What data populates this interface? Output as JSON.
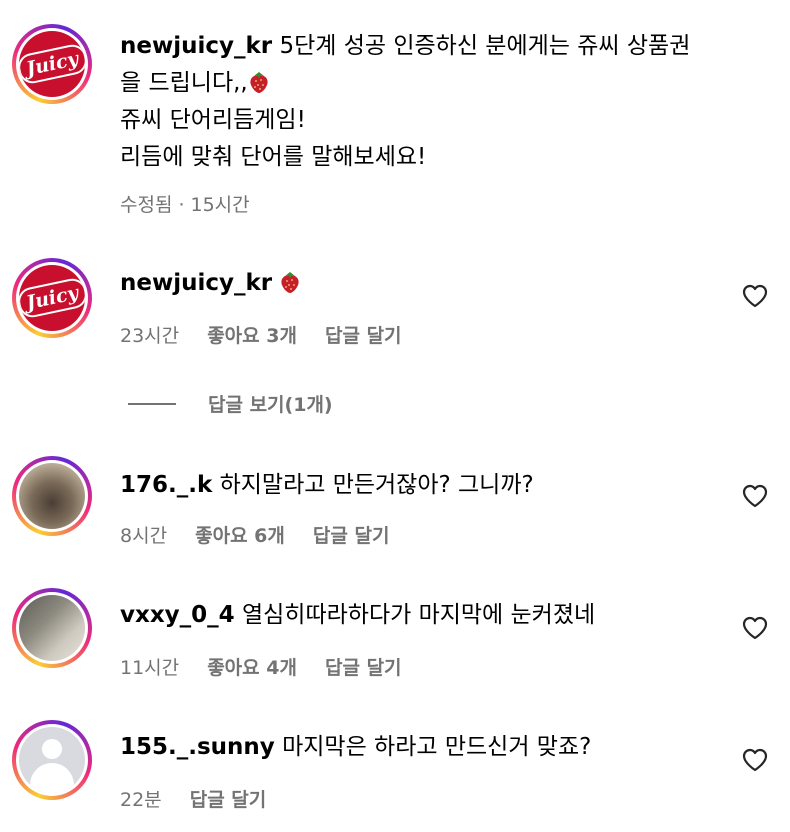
{
  "comments": [
    {
      "username": "newjuicy_kr",
      "text_line1": "5단계 성공 인증하신 분에게는 쥬씨 상품권",
      "text_line2": "을 드립니다,,",
      "text_line3": "쥬씨 단어리듬게임!",
      "text_line4": "리듬에 맞춰 단어를 말해보세요!",
      "edited": "수정됨",
      "separator": "·",
      "time": "15시간"
    },
    {
      "username": "newjuicy_kr",
      "time": "23시간",
      "likes": "좋아요 3개",
      "reply": "답글 달기",
      "view_replies": "답글 보기(1개)"
    },
    {
      "username": "176._.k",
      "text": "하지말라고 만든거잖아? 그니까?",
      "time": "8시간",
      "likes": "좋아요 6개",
      "reply": "답글 달기"
    },
    {
      "username": "vxxy_0_4",
      "text": "열심히따라하다가 마지막에 눈커졌네",
      "time": "11시간",
      "likes": "좋아요 4개",
      "reply": "답글 달기"
    },
    {
      "username": "155._.sunny",
      "text": "마지막은 하라고 만드신거 맞죠?",
      "time": "22분",
      "reply": "답글 달기"
    }
  ],
  "logo_text": "Juicy",
  "icons": {
    "like": "heart-outline-icon",
    "emoji": "strawberry-emoji"
  },
  "colors": {
    "brand_red": "#c8102e",
    "meta_gray": "#737373"
  }
}
